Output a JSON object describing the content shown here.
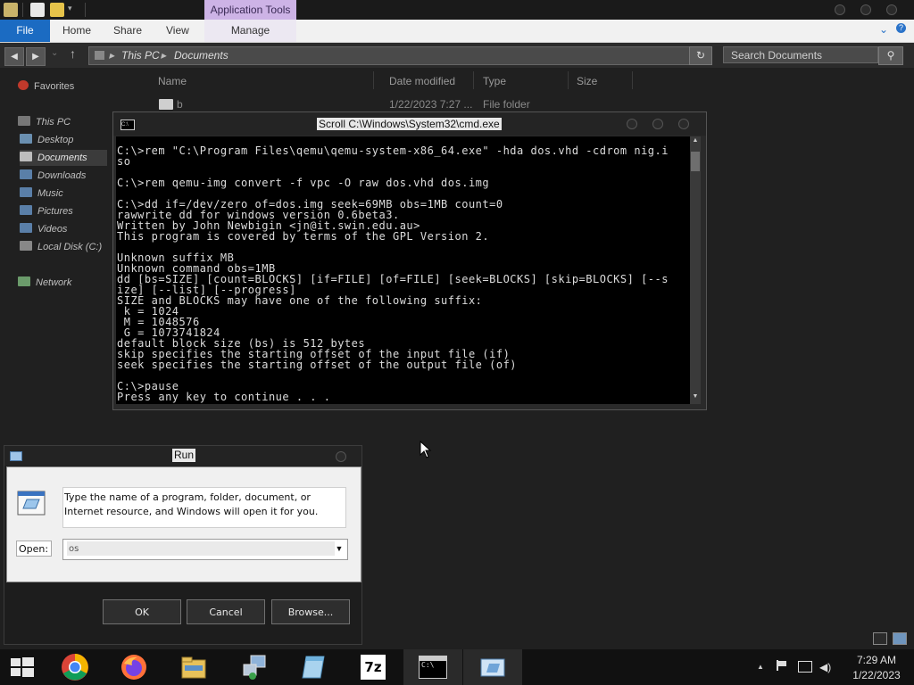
{
  "explorer": {
    "ribbon": {
      "file_tab": "File",
      "tabs": [
        "Home",
        "Share",
        "View"
      ],
      "contextual_group": "Application Tools",
      "contextual_tab": "Manage"
    },
    "address": {
      "root": "This PC",
      "sep": "▸",
      "current": "Documents"
    },
    "search_placeholder": "Search Documents",
    "nav_pane": {
      "favorites": "Favorites",
      "this_pc": "This PC",
      "items": [
        "Desktop",
        "Documents",
        "Downloads",
        "Music",
        "Pictures",
        "Videos",
        "Local Disk (C:)"
      ],
      "network": "Network"
    },
    "columns": [
      "Name",
      "Date modified",
      "Type",
      "Size"
    ],
    "files": [
      {
        "name": "b",
        "date": "1/22/2023 7:27 ...",
        "type": "File folder"
      }
    ]
  },
  "cmd": {
    "title": "Scroll C:\\Windows\\System32\\cmd.exe",
    "icon_text": "C:\\",
    "lines": [
      "C:\\>rem \"C:\\Program Files\\qemu\\qemu-system-x86_64.exe\" -hda dos.vhd -cdrom nig.i",
      "so",
      "",
      "C:\\>rem qemu-img convert -f vpc -O raw dos.vhd dos.img",
      "",
      "C:\\>dd if=/dev/zero of=dos.img seek=69MB obs=1MB count=0",
      "rawwrite dd for windows version 0.6beta3.",
      "Written by John Newbigin <jn@it.swin.edu.au>",
      "This program is covered by terms of the GPL Version 2.",
      "",
      "Unknown suffix MB",
      "Unknown command obs=1MB",
      "dd [bs=SIZE] [count=BLOCKS] [if=FILE] [of=FILE] [seek=BLOCKS] [skip=BLOCKS] [--s",
      "ize] [--list] [--progress]",
      "SIZE and BLOCKS may have one of the following suffix:",
      " k = 1024",
      " M = 1048576",
      " G = 1073741824",
      "default block size (bs) is 512 bytes",
      "skip specifies the starting offset of the input file (if)",
      "seek specifies the starting offset of the output file (of)",
      "",
      "C:\\>pause",
      "Press any key to continue . . ."
    ]
  },
  "run": {
    "title": "Run",
    "description_line1": "Type the name of a program, folder, document, or",
    "description_line2": "Internet resource, and Windows will open it for you.",
    "open_label": "Open:",
    "open_value": "os",
    "ok": "OK",
    "cancel": "Cancel",
    "browse": "Browse..."
  },
  "taskbar": {
    "apps": [
      "start",
      "chrome",
      "firefox",
      "file-explorer",
      "network-setup",
      "notepad",
      "7-zip",
      "command-prompt",
      "run"
    ],
    "seven_zip_text": "7z",
    "cmd_icon_text": "C:\\",
    "tray_chevron": "▲",
    "time": "7:29 AM",
    "date": "1/22/2023"
  },
  "colors": {
    "file_tab": "#1b6bc2",
    "app_tools": "#cdb3e6",
    "desktop_bg": "#202020",
    "console_bg": "#000000",
    "console_fg": "#dcdcdc"
  }
}
